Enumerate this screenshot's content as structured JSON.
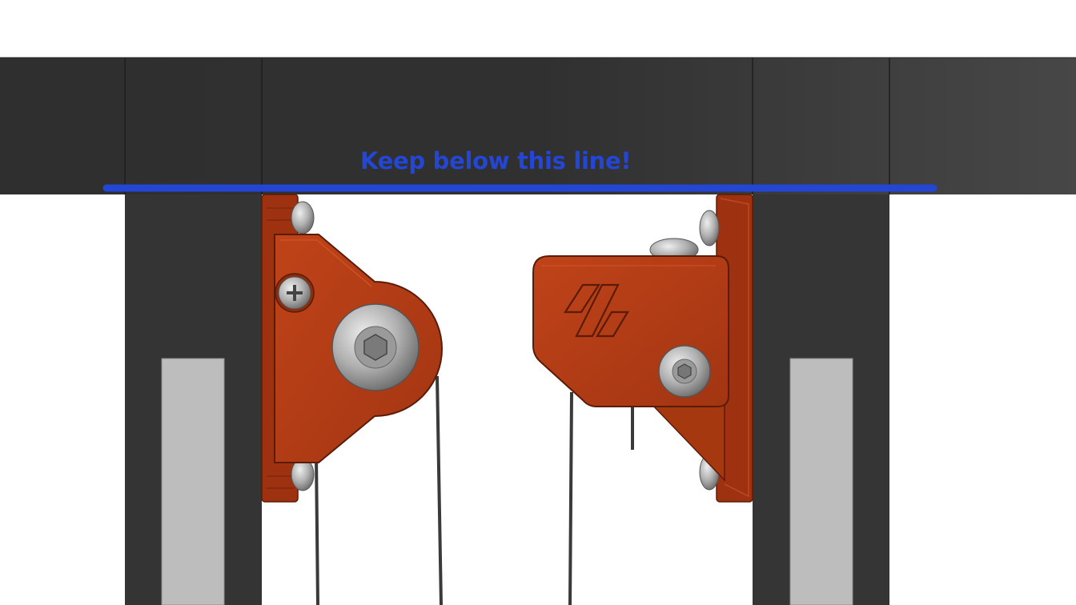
{
  "annotation": {
    "text": "Keep below this line!",
    "color": "#2346d4"
  },
  "colors": {
    "frame": "#333333",
    "bracket": "#b13a14",
    "bolt": "#b8b8b8",
    "rail": "#bdbdbd"
  },
  "parts": {
    "left_bracket_icon": "phillips-screw-icon",
    "bolt_icon": "hex-socket-bolt-icon",
    "logo_icon": "slash-logo-icon"
  }
}
